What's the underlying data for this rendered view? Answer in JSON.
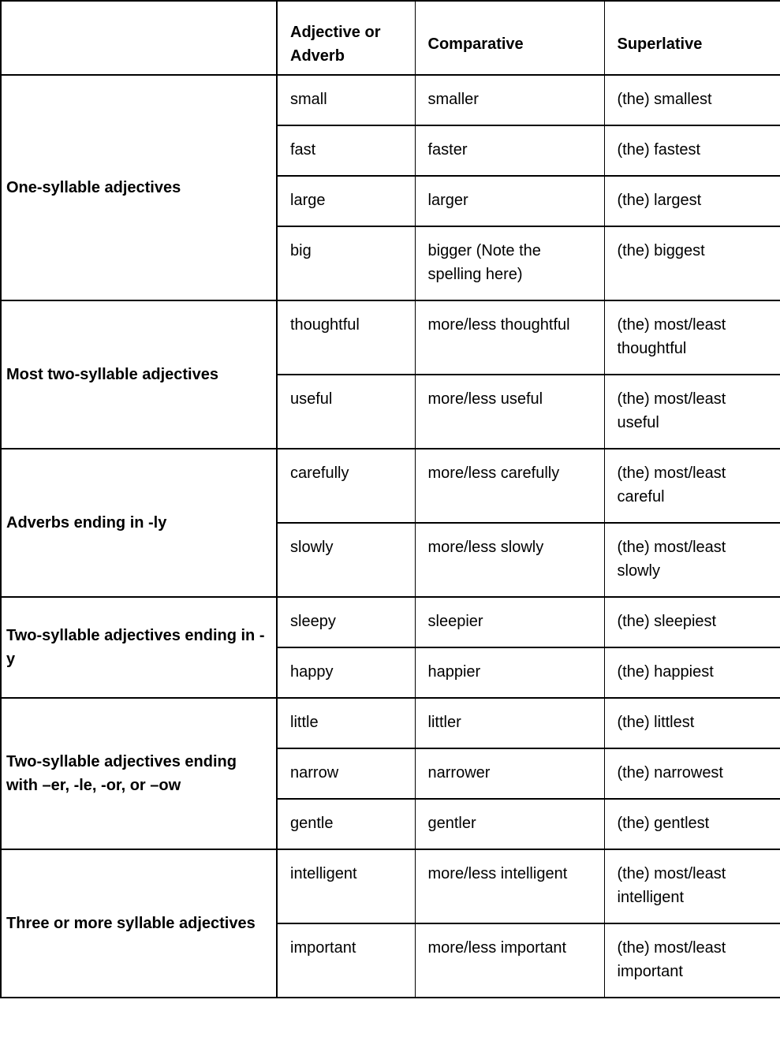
{
  "header": {
    "category": "",
    "form": "Adjective or Adverb",
    "comparative": "Comparative",
    "superlative": "Superlative"
  },
  "groups": [
    {
      "category": "One-syllable adjectives",
      "rows": [
        {
          "form": "small",
          "comparative": "smaller",
          "superlative": "(the) smallest"
        },
        {
          "form": "fast",
          "comparative": "faster",
          "superlative": "(the) fastest"
        },
        {
          "form": "large",
          "comparative": "larger",
          "superlative": "(the) largest"
        },
        {
          "form": "big",
          "comparative": "bigger (Note the spelling here)",
          "superlative": "(the) biggest"
        }
      ]
    },
    {
      "category": "Most two-syllable adjectives",
      "rows": [
        {
          "form": "thoughtful",
          "comparative": "more/less thoughtful",
          "superlative": "(the) most/least thoughtful"
        },
        {
          "form": "useful",
          "comparative": "more/less useful",
          "superlative": "(the) most/least useful"
        }
      ]
    },
    {
      "category": "Adverbs ending in -ly",
      "rows": [
        {
          "form": "carefully",
          "comparative": "more/less carefully",
          "superlative": "(the) most/least careful"
        },
        {
          "form": "slowly",
          "comparative": "more/less slowly",
          "superlative": "(the) most/least slowly"
        }
      ]
    },
    {
      "category": "Two-syllable adjectives ending in -y",
      "rows": [
        {
          "form": "sleepy",
          "comparative": "sleepier",
          "superlative": "(the) sleepiest"
        },
        {
          "form": "happy",
          "comparative": "happier",
          "superlative": "(the) happiest"
        }
      ]
    },
    {
      "category": "Two-syllable adjectives ending with –er, -le, -or, or –ow",
      "rows": [
        {
          "form": "little",
          "comparative": "littler",
          "superlative": "(the) littlest"
        },
        {
          "form": "narrow",
          "comparative": "narrower",
          "superlative": "(the) narrowest"
        },
        {
          "form": "gentle",
          "comparative": "gentler",
          "superlative": "(the) gentlest"
        }
      ]
    },
    {
      "category": "Three or more syllable adjectives",
      "rows": [
        {
          "form": "intelligent",
          "comparative": "more/less intelligent",
          "superlative": "(the) most/least intelligent"
        },
        {
          "form": "important",
          "comparative": "more/less important",
          "superlative": "(the) most/least important"
        }
      ]
    }
  ]
}
